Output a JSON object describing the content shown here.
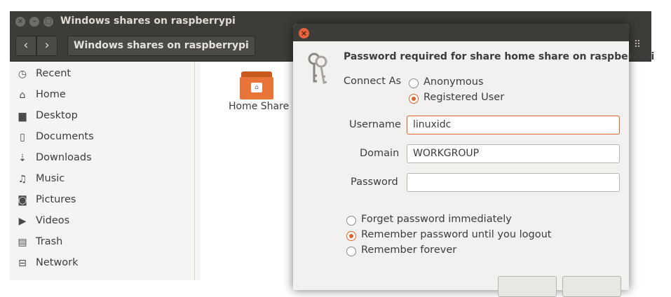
{
  "window": {
    "title": "Windows shares on raspberrypi",
    "controls": {
      "close": "×",
      "minimize": "–",
      "maximize": "□"
    }
  },
  "toolbar": {
    "back_icon": "‹",
    "forward_icon": "›",
    "path_label": "Windows shares on raspberrypi",
    "view_icon": "⠿"
  },
  "sidebar": {
    "items": [
      {
        "label": "Recent",
        "icon": "clock-icon",
        "glyph": "◷"
      },
      {
        "label": "Home",
        "icon": "home-icon",
        "glyph": "⌂"
      },
      {
        "label": "Desktop",
        "icon": "folder-icon",
        "glyph": "▆"
      },
      {
        "label": "Documents",
        "icon": "document-icon",
        "glyph": "▯"
      },
      {
        "label": "Downloads",
        "icon": "download-icon",
        "glyph": "⇣"
      },
      {
        "label": "Music",
        "icon": "music-icon",
        "glyph": "♫"
      },
      {
        "label": "Pictures",
        "icon": "camera-icon",
        "glyph": "◙"
      },
      {
        "label": "Videos",
        "icon": "video-icon",
        "glyph": "▶"
      },
      {
        "label": "Trash",
        "icon": "trash-icon",
        "glyph": "▤"
      },
      {
        "label": "Network",
        "icon": "network-icon",
        "glyph": "⊟"
      }
    ]
  },
  "content": {
    "items": [
      {
        "label": "Home Share",
        "icon": "shared-folder-icon"
      }
    ]
  },
  "dialog": {
    "close_glyph": "×",
    "title": "Password required for share home share on raspberrypi",
    "connect_as_label": "Connect As",
    "connect_options": [
      {
        "label": "Anonymous",
        "selected": false
      },
      {
        "label": "Registered User",
        "selected": true
      }
    ],
    "username_label": "Username",
    "username_value": "linuxidc",
    "domain_label": "Domain",
    "domain_value": "WORKGROUP",
    "password_label": "Password",
    "password_value": "",
    "remember_options": [
      {
        "label": "Forget password immediately",
        "selected": false
      },
      {
        "label": "Remember password until you logout",
        "selected": true
      },
      {
        "label": "Remember forever",
        "selected": false
      }
    ]
  },
  "colors": {
    "accent": "#e0622b",
    "titlebar": "#3d3c38",
    "folder": "#e8743a"
  }
}
